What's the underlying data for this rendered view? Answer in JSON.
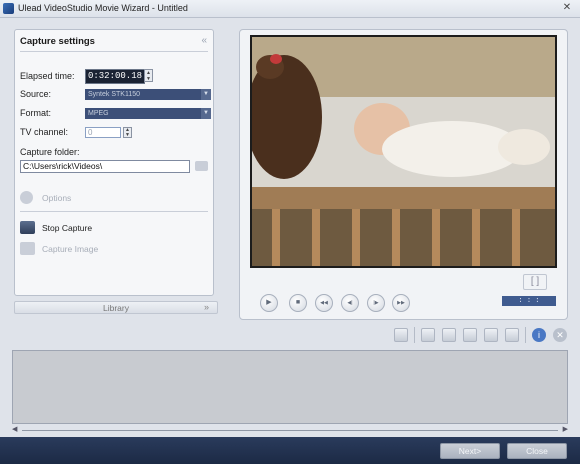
{
  "window": {
    "title": "Ulead VideoStudio Movie Wizard - Untitled",
    "close_glyph": "✕"
  },
  "capture": {
    "panel_title": "Capture settings",
    "collapse_glyph": "«",
    "elapsed_label": "Elapsed time:",
    "elapsed_value": "0:32:00.18",
    "source_label": "Source:",
    "source_value": "Syntek STK1150",
    "format_label": "Format:",
    "format_value": "MPEG",
    "tv_channel_label": "TV channel:",
    "tv_channel_value": "0",
    "folder_label": "Capture folder:",
    "folder_value": "C:\\Users\\rick\\Videos\\",
    "options_label": "Options",
    "stop_capture_label": "Stop Capture",
    "capture_image_label": "Capture Image"
  },
  "library": {
    "label": "Library",
    "expand_glyph": "»"
  },
  "preview": {
    "mark_glyph": "[ ]",
    "timecode": ": : :",
    "controls": [
      {
        "name": "play",
        "glyph": "▶"
      },
      {
        "name": "stop",
        "glyph": "■"
      },
      {
        "name": "rewind",
        "glyph": "◀◀"
      },
      {
        "name": "prev-frame",
        "glyph": "◀|"
      },
      {
        "name": "next-frame",
        "glyph": "|▶"
      },
      {
        "name": "forward",
        "glyph": "▶▶"
      }
    ]
  },
  "colors": {
    "accent": "#3c4f78",
    "bottom_bar": "#1c2a45",
    "help": "#4a78c4",
    "close": "#b9c0cc"
  },
  "footer": {
    "next_label": "Next>",
    "close_label": "Close"
  }
}
